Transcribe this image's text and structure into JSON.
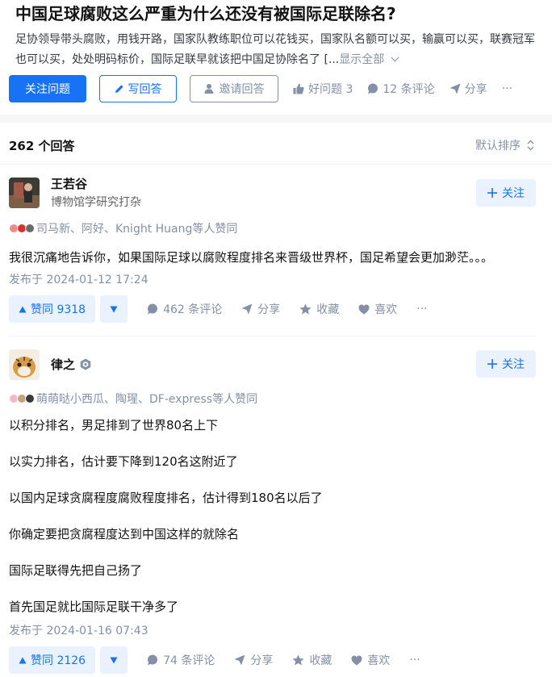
{
  "question": {
    "title": "中国足球腐败这么严重为什么还没有被国际足联除名?",
    "description": "足协领导带头腐败，用钱开路，国家队教练职位可以花钱买，国家队名额可以买，输赢可以买，联赛冠军也可以买，处处明码标价，国际足联早就该把中国足协除名了 [...",
    "show_all": "显示全部",
    "actions": {
      "follow": "关注问题",
      "write": "写回答",
      "invite": "邀请回答",
      "good": "好问题 3",
      "comments": "12 条评论",
      "share": "分享",
      "more": "···"
    }
  },
  "list": {
    "count": "262 个回答",
    "sort": "默认排序"
  },
  "answers": [
    {
      "author": "王若谷",
      "headline": "博物馆学研究打杂",
      "follow": "关注",
      "voters": "司马新、阿好、Knight Huang等人赞同",
      "paragraphs": [
        "我很沉痛地告诉你，如果国际足球以腐败程度排名来晋级世界杯，国足希望会更加渺茫。。。"
      ],
      "published": "发布于 2024-01-12 17:24",
      "vote": "赞同 9318",
      "comments": "462 条评论",
      "share": "分享",
      "collect": "收藏",
      "like": "喜欢",
      "more": "···"
    },
    {
      "author": "律之",
      "headline": "",
      "follow": "关注",
      "voters": "萌萌哒小西瓜、陶瑆、DF-express等人赞同",
      "paragraphs": [
        "以积分排名，男足排到了世界80名上下",
        "以实力排名，估计要下降到120名这附近了",
        "以国内足球贪腐程度腐败程度排名，估计得到180名以后了",
        "你确定要把贪腐程度达到中国这样的就除名",
        "国际足联得先把自己扬了",
        "首先国足就比国际足联干净多了"
      ],
      "published": "发布于 2024-01-16 07:43",
      "vote": "赞同 2126",
      "comments": "74 条评论",
      "share": "分享",
      "collect": "收藏",
      "like": "喜欢",
      "more": "···"
    }
  ],
  "colors": {
    "accent": "#1772f6",
    "muted": "#8590a6",
    "vote_bg": "#eaf2ff"
  }
}
